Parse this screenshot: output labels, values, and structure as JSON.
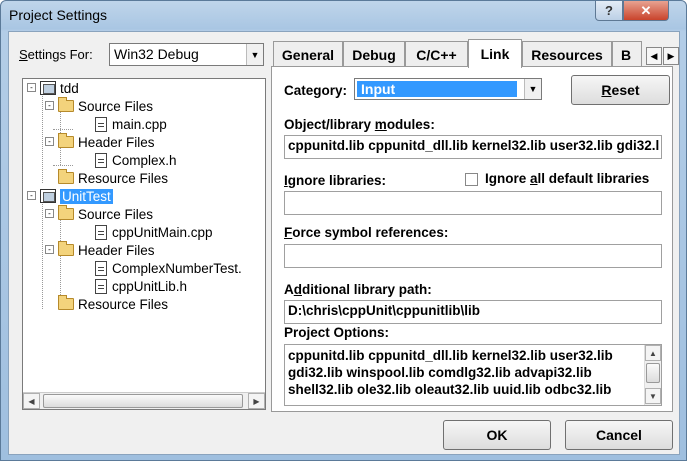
{
  "window": {
    "title": "Project Settings",
    "help_glyph": "?",
    "close_glyph": "✕"
  },
  "left": {
    "settings_for_label": "Settings For:",
    "settings_for_value": "Win32 Debug",
    "tree": [
      {
        "label": "tdd",
        "icon": "project-icon",
        "expander": "-"
      },
      {
        "label": "Source Files",
        "icon": "folder-icon",
        "expander": "-"
      },
      {
        "label": "main.cpp",
        "icon": "file-icon"
      },
      {
        "label": "Header Files",
        "icon": "folder-icon",
        "expander": "-"
      },
      {
        "label": "Complex.h",
        "icon": "file-icon"
      },
      {
        "label": "Resource Files",
        "icon": "folder-icon"
      },
      {
        "label": "UnitTest",
        "icon": "project-icon",
        "expander": "-",
        "selected": true
      },
      {
        "label": "Source Files",
        "icon": "folder-icon",
        "expander": "-"
      },
      {
        "label": "cppUnitMain.cpp",
        "icon": "file-icon"
      },
      {
        "label": "Header Files",
        "icon": "folder-icon",
        "expander": "-"
      },
      {
        "label": "ComplexNumberTest.",
        "icon": "file-icon"
      },
      {
        "label": "cppUnitLib.h",
        "icon": "file-icon"
      },
      {
        "label": "Resource Files",
        "icon": "folder-icon"
      }
    ]
  },
  "tabs": [
    {
      "label": "General"
    },
    {
      "label": "Debug"
    },
    {
      "label": "C/C++"
    },
    {
      "label": "Link",
      "active": true
    },
    {
      "label": "Resources"
    },
    {
      "label": "B"
    }
  ],
  "link": {
    "category_label": "Category:",
    "category_value": "Input",
    "reset_label": "Reset",
    "modules_label": "Object/library modules:",
    "modules_value": "cppunitd.lib cppunitd_dll.lib kernel32.lib user32.lib gdi32.l",
    "ignore_label": "Ignore libraries:",
    "ignore_value": "",
    "ignore_all_label": "Ignore all default libraries",
    "ignore_all_checked": false,
    "force_label": "Force symbol references:",
    "force_value": "",
    "additional_path_label": "Additional library path:",
    "additional_path_value": "D:\\chris\\cppUnit\\cppunitlib\\lib",
    "project_options_label": "Project Options:",
    "project_options_lines": [
      "cppunitd.lib cppunitd_dll.lib kernel32.lib user32.lib",
      "gdi32.lib winspool.lib comdlg32.lib advapi32.lib",
      "shell32.lib ole32.lib oleaut32.lib uuid.lib odbc32.lib"
    ]
  },
  "footer": {
    "ok_label": "OK",
    "cancel_label": "Cancel"
  },
  "colors": {
    "selection": "#3399ff",
    "close_button": "#c9442c",
    "title_bar": "#a9c6e3"
  }
}
